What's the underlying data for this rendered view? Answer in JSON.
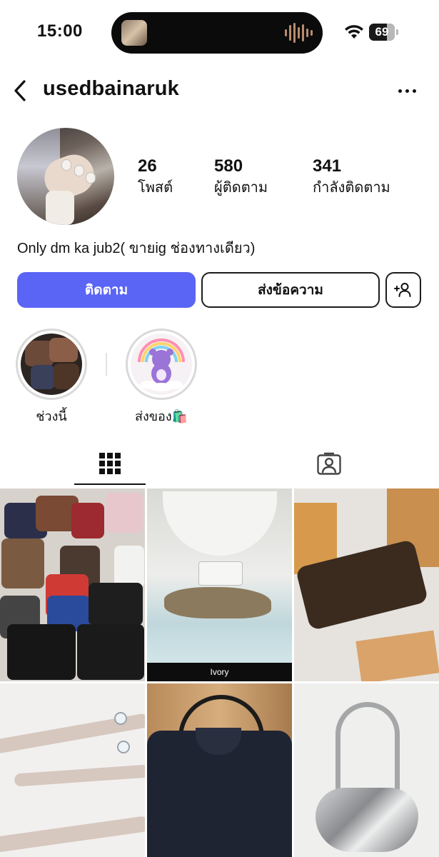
{
  "status_bar": {
    "time": "15:00",
    "battery_level": "69"
  },
  "header": {
    "username": "usedbainaruk"
  },
  "profile": {
    "stats": [
      {
        "value": "26",
        "label": "โพสต์"
      },
      {
        "value": "580",
        "label": "ผู้ติดตาม"
      },
      {
        "value": "341",
        "label": "กำลังติดตาม"
      }
    ],
    "bio": "Only dm ka jub2( ขายig ช่องทางเดียว)"
  },
  "actions": {
    "follow_label": "ติดตาม",
    "message_label": "ส่งข้อความ"
  },
  "highlights": [
    {
      "label": "ช่วงนี้"
    },
    {
      "label": "ส่งของ🛍️"
    }
  ],
  "tabs": {
    "posts_icon": "grid-icon",
    "tagged_icon": "tagged-person-icon"
  },
  "posts": [
    {
      "label": ""
    },
    {
      "label": "Ivory"
    },
    {
      "label": ""
    },
    {
      "label": ""
    },
    {
      "label": ""
    },
    {
      "label": ""
    }
  ],
  "colors": {
    "follow_button": "#5a64f5",
    "text": "#111111",
    "background": "#ffffff"
  }
}
